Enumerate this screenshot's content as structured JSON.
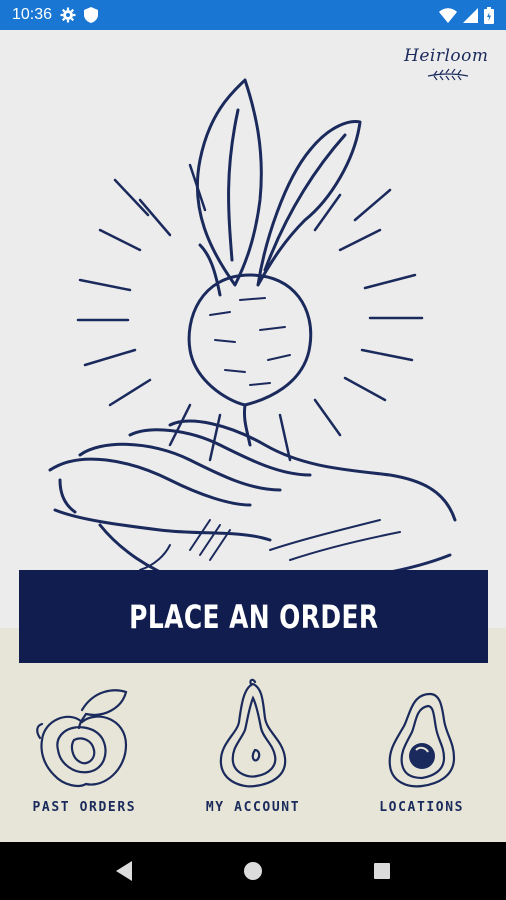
{
  "status_bar": {
    "time": "10:36",
    "icons": [
      "gear-icon",
      "shield-icon",
      "wifi-icon",
      "signal-icon",
      "battery-icon"
    ],
    "background": "#1976d2"
  },
  "brand": {
    "name": "Heirloom"
  },
  "hero": {
    "illustration": "beet-over-hand-illustration"
  },
  "cta": {
    "label": "PLACE AN ORDER",
    "background": "#111d4e"
  },
  "nav_tiles": [
    {
      "label": "PAST ORDERS",
      "icon": "apple-half-icon"
    },
    {
      "label": "MY ACCOUNT",
      "icon": "pear-half-icon"
    },
    {
      "label": "LOCATIONS",
      "icon": "avocado-half-icon"
    }
  ],
  "system_nav": {
    "buttons": [
      "back-icon",
      "home-icon",
      "recents-icon"
    ]
  },
  "colors": {
    "ink": "#1b2a5c",
    "panel": "#e6e5d7",
    "hero_bg": "#ececec"
  }
}
